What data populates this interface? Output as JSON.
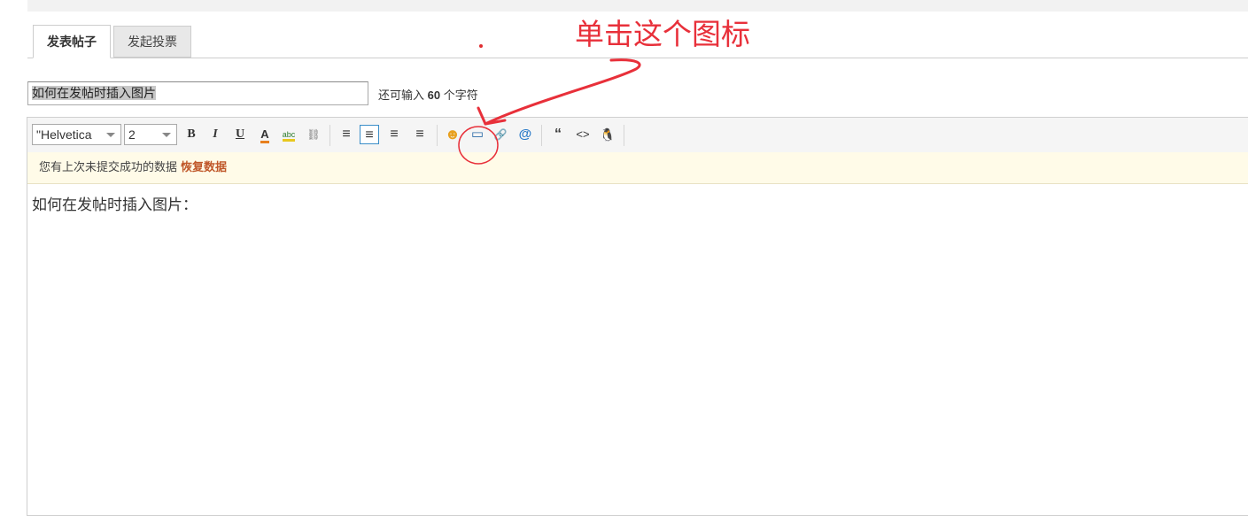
{
  "tabs": [
    {
      "label": "发表帖子",
      "active": true
    },
    {
      "label": "发起投票",
      "active": false
    }
  ],
  "subject": {
    "value": "如何在发帖时插入图片",
    "counter_prefix": "还可输入",
    "counter_value": "60",
    "counter_suffix": "个字符"
  },
  "toolbar": {
    "font_family": "\"Helvetica",
    "font_size": "2",
    "buttons": [
      {
        "name": "bold-icon",
        "glyph": "B"
      },
      {
        "name": "italic-icon",
        "glyph": "I"
      },
      {
        "name": "underline-icon",
        "glyph": "U"
      },
      {
        "name": "font-color-icon",
        "glyph": "A"
      },
      {
        "name": "background-color-icon",
        "glyph": "abc"
      },
      {
        "name": "link-icon",
        "glyph": "⛓"
      },
      {
        "name": "align-left-icon",
        "glyph": "≡"
      },
      {
        "name": "align-justify-icon",
        "glyph": "≡"
      },
      {
        "name": "align-center-icon",
        "glyph": "≡"
      },
      {
        "name": "align-right-icon",
        "glyph": "≡"
      },
      {
        "name": "emoji-icon",
        "glyph": "☻"
      },
      {
        "name": "insert-image-icon",
        "glyph": "▭"
      },
      {
        "name": "attachment-icon",
        "glyph": "🔗"
      },
      {
        "name": "mention-icon",
        "glyph": "@"
      },
      {
        "name": "quote-icon",
        "glyph": "“"
      },
      {
        "name": "code-icon",
        "glyph": "<>"
      },
      {
        "name": "qq-icon",
        "glyph": "🐧"
      }
    ]
  },
  "notice": {
    "text": "您有上次未提交成功的数据",
    "restore_label": "恢复数据"
  },
  "editor_body": "如何在发帖时插入图片：",
  "annotation": {
    "text": "单击这个图标",
    "color": "#e8303a"
  },
  "colors": {
    "restore": "#c0582a",
    "pressed_border": "#3a8ec8",
    "notice_bg": "#fffbe8"
  }
}
